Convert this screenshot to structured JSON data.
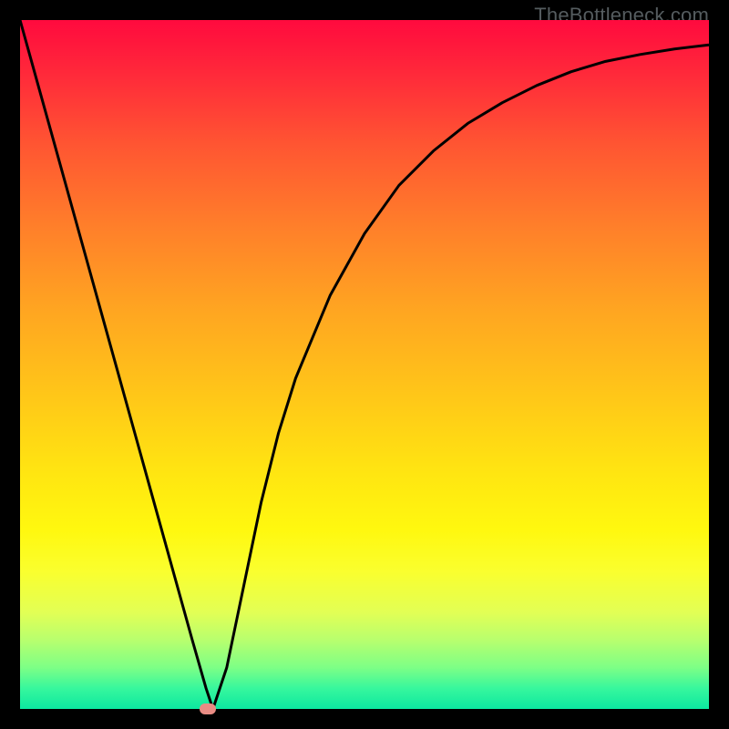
{
  "watermark": "TheBottleneck.com",
  "colors": {
    "curve": "#000000",
    "marker": "#e98c84",
    "frame": "#000000"
  },
  "chart_data": {
    "type": "line",
    "title": "",
    "xlabel": "",
    "ylabel": "",
    "xlim": [
      0,
      100
    ],
    "ylim": [
      0,
      100
    ],
    "grid": false,
    "legend": false,
    "series": [
      {
        "name": "bottleneck-curve",
        "x": [
          0,
          2.5,
          5,
          7.5,
          10,
          12.5,
          15,
          17.5,
          20,
          22.5,
          25,
          27,
          28,
          30,
          32.5,
          35,
          37.5,
          40,
          45,
          50,
          55,
          60,
          65,
          70,
          75,
          80,
          85,
          90,
          95,
          100
        ],
        "y": [
          100,
          91,
          82,
          73,
          64,
          55,
          46,
          37,
          28,
          19,
          10,
          3,
          0,
          6,
          18,
          30,
          40,
          48,
          60,
          69,
          76,
          81,
          85,
          88,
          90.5,
          92.5,
          94,
          95,
          95.8,
          96.4
        ]
      }
    ],
    "annotations": [
      {
        "name": "optimal-point-marker",
        "x": 27.3,
        "y": 0,
        "shape": "pill",
        "color": "#e98c84"
      }
    ]
  }
}
